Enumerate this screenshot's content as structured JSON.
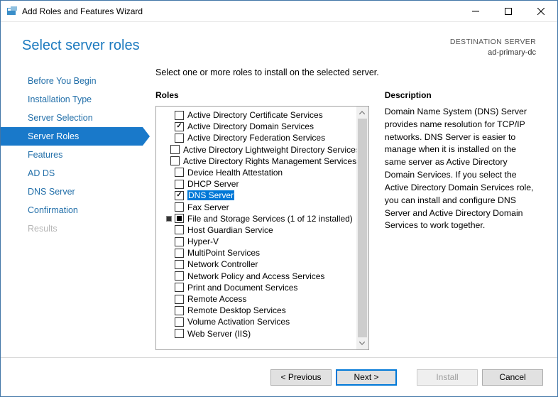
{
  "window": {
    "title": "Add Roles and Features Wizard"
  },
  "header": {
    "page_title": "Select server roles",
    "dest_label": "DESTINATION SERVER",
    "dest_value": "ad-primary-dc"
  },
  "nav": {
    "items": [
      {
        "label": "Before You Begin",
        "state": "normal"
      },
      {
        "label": "Installation Type",
        "state": "normal"
      },
      {
        "label": "Server Selection",
        "state": "normal"
      },
      {
        "label": "Server Roles",
        "state": "selected"
      },
      {
        "label": "Features",
        "state": "normal"
      },
      {
        "label": "AD DS",
        "state": "normal"
      },
      {
        "label": "DNS Server",
        "state": "normal"
      },
      {
        "label": "Confirmation",
        "state": "normal"
      },
      {
        "label": "Results",
        "state": "disabled"
      }
    ]
  },
  "content": {
    "intro": "Select one or more roles to install on the selected server.",
    "roles_heading": "Roles",
    "desc_heading": "Description",
    "description": "Domain Name System (DNS) Server provides name resolution for TCP/IP networks. DNS Server is easier to manage when it is installed on the same server as Active Directory Domain Services. If you select the Active Directory Domain Services role, you can install and configure DNS Server and Active Directory Domain Services to work together.",
    "roles": [
      {
        "label": "Active Directory Certificate Services",
        "checked": false
      },
      {
        "label": "Active Directory Domain Services",
        "checked": true
      },
      {
        "label": "Active Directory Federation Services",
        "checked": false
      },
      {
        "label": "Active Directory Lightweight Directory Services",
        "checked": false
      },
      {
        "label": "Active Directory Rights Management Services",
        "checked": false
      },
      {
        "label": "Device Health Attestation",
        "checked": false
      },
      {
        "label": "DHCP Server",
        "checked": false
      },
      {
        "label": "DNS Server",
        "checked": true,
        "selected": true
      },
      {
        "label": "Fax Server",
        "checked": false
      },
      {
        "label": "File and Storage Services (1 of 12 installed)",
        "checked": "partial",
        "has_child": true
      },
      {
        "label": "Host Guardian Service",
        "checked": false
      },
      {
        "label": "Hyper-V",
        "checked": false
      },
      {
        "label": "MultiPoint Services",
        "checked": false
      },
      {
        "label": "Network Controller",
        "checked": false
      },
      {
        "label": "Network Policy and Access Services",
        "checked": false
      },
      {
        "label": "Print and Document Services",
        "checked": false
      },
      {
        "label": "Remote Access",
        "checked": false
      },
      {
        "label": "Remote Desktop Services",
        "checked": false
      },
      {
        "label": "Volume Activation Services",
        "checked": false
      },
      {
        "label": "Web Server (IIS)",
        "checked": false
      }
    ]
  },
  "footer": {
    "previous": "< Previous",
    "next": "Next >",
    "install": "Install",
    "cancel": "Cancel"
  }
}
